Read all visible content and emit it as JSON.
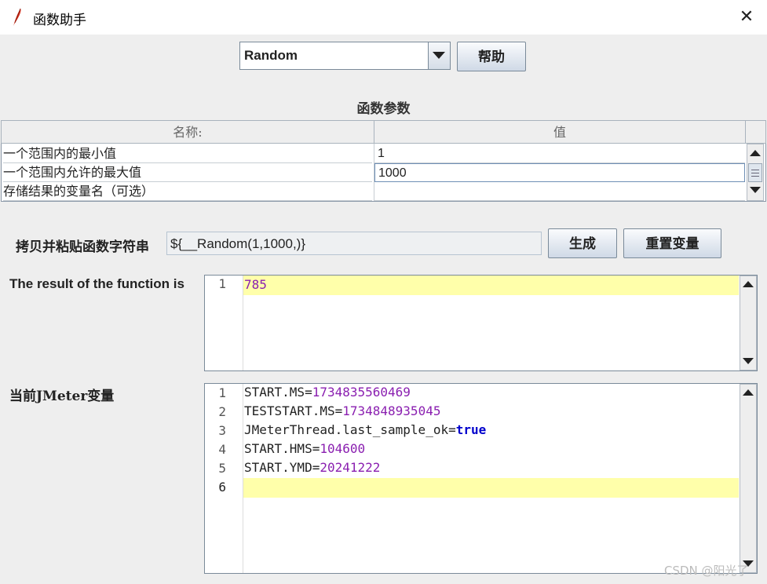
{
  "window": {
    "title": "函数助手",
    "close_glyph": "✕"
  },
  "function_select": {
    "selected": "Random",
    "help_label": "帮助"
  },
  "params": {
    "section_title": "函数参数",
    "headers": [
      "名称:",
      "值"
    ],
    "rows": [
      {
        "name": "一个范围内的最小值",
        "value": "1"
      },
      {
        "name": "一个范围内允许的最大值",
        "value": "1000"
      },
      {
        "name": "存储结果的变量名（可选）",
        "value": ""
      }
    ]
  },
  "function_string": {
    "label": "拷贝并粘贴函数字符串",
    "value": "${__Random(1,1000,)}",
    "generate_label": "生成",
    "reset_label": "重置变量"
  },
  "result": {
    "label": "The result of the function is",
    "lines": [
      {
        "no": "1",
        "text": "785"
      }
    ]
  },
  "variables": {
    "label": "当前JMeter变量",
    "lines": [
      {
        "no": "1",
        "key": "START.MS",
        "eq": "=",
        "val": "1734835560469"
      },
      {
        "no": "2",
        "key": "TESTSTART.MS",
        "eq": "=",
        "val": "1734848935045"
      },
      {
        "no": "3",
        "key": "JMeterThread.last_sample_ok",
        "eq": "=",
        "val": "true"
      },
      {
        "no": "4",
        "key": "START.HMS",
        "eq": "=",
        "val": "104600"
      },
      {
        "no": "5",
        "key": "START.YMD",
        "eq": "=",
        "val": "20241222"
      },
      {
        "no": "6",
        "key": "",
        "eq": "",
        "val": ""
      }
    ]
  },
  "watermark": "CSDN @阳光了"
}
